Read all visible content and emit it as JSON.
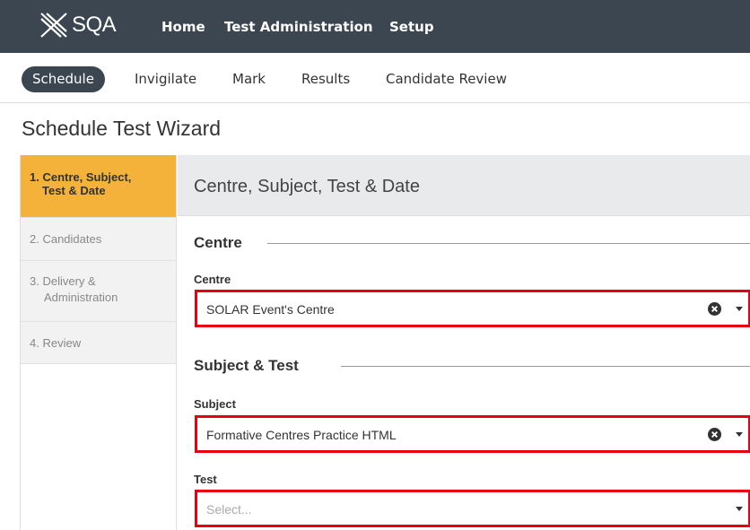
{
  "brand": {
    "logo_text": "SQA"
  },
  "topnav": {
    "home": "Home",
    "test_administration": "Test Administration",
    "setup": "Setup"
  },
  "subnav": {
    "items": [
      "Schedule",
      "Invigilate",
      "Mark",
      "Results",
      "Candidate Review"
    ],
    "active": "Schedule"
  },
  "page": {
    "title": "Schedule Test Wizard"
  },
  "wizard": {
    "steps": [
      {
        "line1": "1. Centre, Subject,",
        "line2": "Test & Date"
      },
      {
        "line1": "2. Candidates",
        "line2": ""
      },
      {
        "line1": "3. Delivery &",
        "line2": "Administration"
      },
      {
        "line1": "4. Review",
        "line2": ""
      }
    ],
    "active_step": 1,
    "header_title": "Centre, Subject, Test & Date",
    "sections": {
      "centre": {
        "title": "Centre",
        "field_label": "Centre",
        "value": "SOLAR Event's Centre"
      },
      "subject_test": {
        "title": "Subject & Test",
        "subject_label": "Subject",
        "subject_value": "Formative Centres Practice HTML",
        "test_label": "Test",
        "test_placeholder": "Select..."
      }
    }
  },
  "colors": {
    "topbar": "#3b4650",
    "active_step": "#f5b23a",
    "highlight_border": "#e8000e"
  }
}
